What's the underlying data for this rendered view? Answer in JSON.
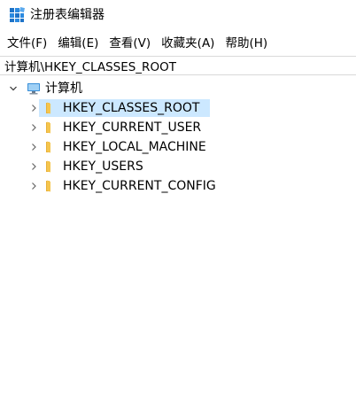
{
  "window": {
    "title": "注册表编辑器",
    "icon": "registry-editor-icon"
  },
  "menu": [
    {
      "label": "文件(F)"
    },
    {
      "label": "编辑(E)"
    },
    {
      "label": "查看(V)"
    },
    {
      "label": "收藏夹(A)"
    },
    {
      "label": "帮助(H)"
    }
  ],
  "address": {
    "value": "计算机\\HKEY_CLASSES_ROOT"
  },
  "tree": {
    "root": {
      "label": "计算机",
      "icon": "computer-icon",
      "expanded": true
    },
    "children": [
      {
        "label": "HKEY_CLASSES_ROOT",
        "icon": "folder-icon",
        "selected": true
      },
      {
        "label": "HKEY_CURRENT_USER",
        "icon": "folder-icon",
        "selected": false
      },
      {
        "label": "HKEY_LOCAL_MACHINE",
        "icon": "folder-icon",
        "selected": false
      },
      {
        "label": "HKEY_USERS",
        "icon": "folder-icon",
        "selected": false
      },
      {
        "label": "HKEY_CURRENT_CONFIG",
        "icon": "folder-icon",
        "selected": false
      }
    ]
  },
  "colors": {
    "selection": "#cce8ff",
    "folder": "#f5c54e",
    "accent": "#0078d7"
  }
}
